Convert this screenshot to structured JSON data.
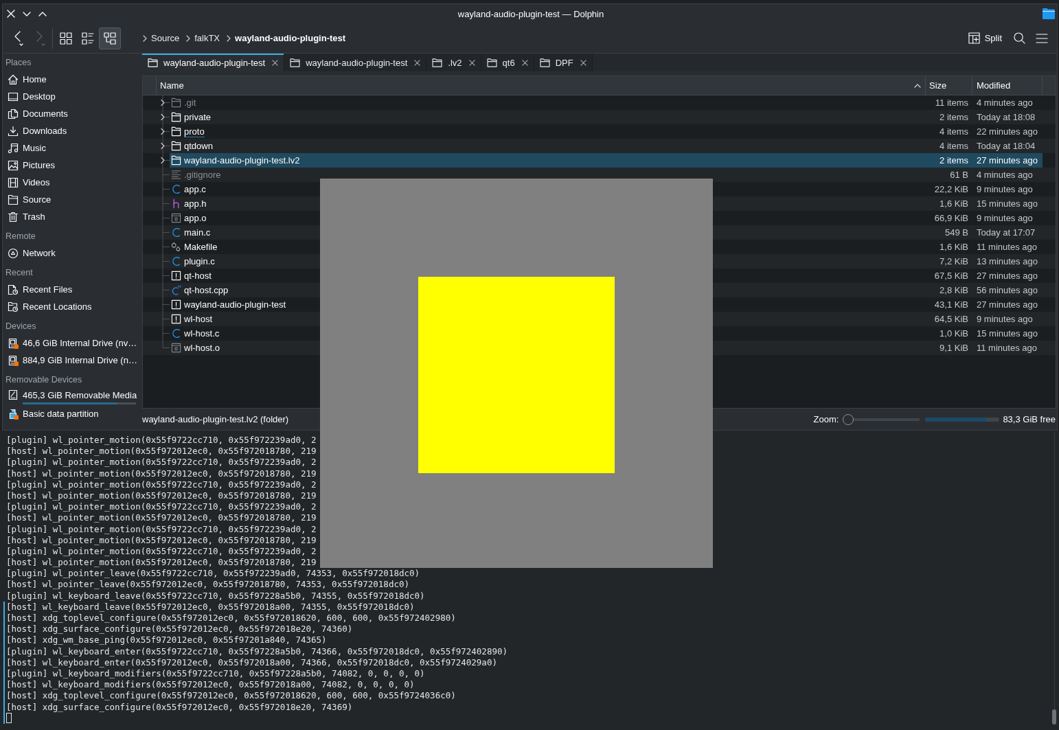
{
  "window": {
    "title": "wayland-audio-plugin-test — Dolphin"
  },
  "toolbar": {
    "back": {
      "disabled": false
    },
    "forward": {
      "disabled": true
    },
    "view_modes": [
      {
        "kind": "icons",
        "selected": false
      },
      {
        "kind": "compact",
        "selected": false
      },
      {
        "kind": "details",
        "selected": true
      }
    ],
    "breadcrumb": [
      {
        "label": "Source",
        "current": false
      },
      {
        "label": "falkTX",
        "current": false
      },
      {
        "label": "wayland-audio-plugin-test",
        "current": true
      }
    ],
    "split": {
      "label": "Split"
    }
  },
  "sidebar": [
    {
      "title": "Places",
      "items": [
        {
          "label": "Home",
          "kind": "home"
        },
        {
          "label": "Desktop",
          "kind": "desktop"
        },
        {
          "label": "Documents",
          "kind": "documents"
        },
        {
          "label": "Downloads",
          "kind": "downloads"
        },
        {
          "label": "Music",
          "kind": "music"
        },
        {
          "label": "Pictures",
          "kind": "pictures"
        },
        {
          "label": "Videos",
          "kind": "videos"
        },
        {
          "label": "Source",
          "kind": "folder"
        },
        {
          "label": "Trash",
          "kind": "trash"
        }
      ]
    },
    {
      "title": "Remote",
      "items": [
        {
          "label": "Network",
          "kind": "network"
        }
      ]
    },
    {
      "title": "Recent",
      "items": [
        {
          "label": "Recent Files",
          "kind": "recentfiles"
        },
        {
          "label": "Recent Locations",
          "kind": "recentlocations"
        }
      ]
    },
    {
      "title": "Devices",
      "items": [
        {
          "label": "46,6 GiB Internal Drive (nv…",
          "kind": "drive",
          "unmounted": true
        },
        {
          "label": "884,9 GiB Internal Drive (n…",
          "kind": "drive",
          "unmounted": true
        }
      ]
    },
    {
      "title": "Removable Devices",
      "items": [
        {
          "label": "465,3 GiB Removable Media",
          "kind": "removable",
          "unmounted": false,
          "level": 0.83
        },
        {
          "label": "Basic data partition",
          "kind": "usb",
          "unmounted": true
        }
      ]
    }
  ],
  "tabs": [
    {
      "label": "wayland-audio-plugin-test",
      "selected": true
    },
    {
      "label": "wayland-audio-plugin-test",
      "selected": false
    },
    {
      "label": ".lv2",
      "selected": false
    },
    {
      "label": "qt6",
      "selected": false
    },
    {
      "label": "DPF",
      "selected": false
    }
  ],
  "files": {
    "columns": [
      {
        "label": "Name",
        "sorted": true
      },
      {
        "label": "Size",
        "sorted": false
      },
      {
        "label": "Modified",
        "sorted": false
      }
    ],
    "rows": [
      {
        "name": ".git",
        "kind": "folder",
        "size": "11 items",
        "modified": "4 minutes ago",
        "selected": false,
        "hidden": true,
        "hovered": false
      },
      {
        "name": "private",
        "kind": "folder",
        "size": "2 items",
        "modified": "Today at 18:08",
        "selected": false,
        "hidden": false,
        "hovered": false
      },
      {
        "name": "proto",
        "kind": "folder",
        "size": "4 items",
        "modified": "22 minutes ago",
        "selected": false,
        "hidden": false,
        "hovered": true
      },
      {
        "name": "qtdown",
        "kind": "folder",
        "size": "4 items",
        "modified": "Today at 18:04",
        "selected": false,
        "hidden": false,
        "hovered": false
      },
      {
        "name": "wayland-audio-plugin-test.lv2",
        "kind": "folder",
        "size": "2 items",
        "modified": "27 minutes ago",
        "selected": true,
        "hidden": false,
        "hovered": false
      },
      {
        "name": ".gitignore",
        "kind": "text",
        "size": "61 B",
        "modified": "4 minutes ago",
        "selected": false,
        "hidden": true,
        "hovered": false
      },
      {
        "name": "app.c",
        "kind": "c",
        "size": "22,2 KiB",
        "modified": "9 minutes ago",
        "selected": false,
        "hidden": false,
        "hovered": false
      },
      {
        "name": "app.h",
        "kind": "header",
        "size": "1,6 KiB",
        "modified": "15 minutes ago",
        "selected": false,
        "hidden": false,
        "hovered": false
      },
      {
        "name": "app.o",
        "kind": "object",
        "size": "66,9 KiB",
        "modified": "9 minutes ago",
        "selected": false,
        "hidden": false,
        "hovered": false
      },
      {
        "name": "main.c",
        "kind": "c",
        "size": "549 B",
        "modified": "Today at 17:07",
        "selected": false,
        "hidden": false,
        "hovered": false
      },
      {
        "name": "Makefile",
        "kind": "makefile",
        "size": "1,6 KiB",
        "modified": "11 minutes ago",
        "selected": false,
        "hidden": false,
        "hovered": false
      },
      {
        "name": "plugin.c",
        "kind": "c",
        "size": "7,2 KiB",
        "modified": "13 minutes ago",
        "selected": false,
        "hidden": false,
        "hovered": false
      },
      {
        "name": "qt-host",
        "kind": "executable",
        "size": "67,5 KiB",
        "modified": "27 minutes ago",
        "selected": false,
        "hidden": false,
        "hovered": false
      },
      {
        "name": "qt-host.cpp",
        "kind": "cpp",
        "size": "2,8 KiB",
        "modified": "56 minutes ago",
        "selected": false,
        "hidden": false,
        "hovered": false
      },
      {
        "name": "wayland-audio-plugin-test",
        "kind": "executable",
        "size": "43,1 KiB",
        "modified": "27 minutes ago",
        "selected": false,
        "hidden": false,
        "hovered": false
      },
      {
        "name": "wl-host",
        "kind": "executable",
        "size": "64,5 KiB",
        "modified": "9 minutes ago",
        "selected": false,
        "hidden": false,
        "hovered": false
      },
      {
        "name": "wl-host.c",
        "kind": "c",
        "size": "1,0 KiB",
        "modified": "15 minutes ago",
        "selected": false,
        "hidden": false,
        "hovered": false
      },
      {
        "name": "wl-host.o",
        "kind": "object",
        "size": "9,1 KiB",
        "modified": "11 minutes ago",
        "selected": false,
        "hidden": false,
        "hovered": false
      }
    ]
  },
  "status_bar": {
    "text": "wayland-audio-plugin-test.lv2 (folder)",
    "zoom_label": "Zoom:",
    "zoom": {
      "level": 0
    },
    "free_space": {
      "level": 0.82
    },
    "free_text": "83,3 GiB free"
  },
  "test_window": {
    "square": true
  },
  "terminal": {
    "lines": [
      {
        "text": "[plugin] wl_pointer_motion(0x55f9722cc710, 0x55f972239ad0, 2",
        "marked": false
      },
      {
        "text": "[host] wl_pointer_motion(0x55f972012ec0, 0x55f972018780, 219",
        "marked": false
      },
      {
        "text": "[plugin] wl_pointer_motion(0x55f9722cc710, 0x55f972239ad0, 2",
        "marked": false
      },
      {
        "text": "[host] wl_pointer_motion(0x55f972012ec0, 0x55f972018780, 219",
        "marked": false
      },
      {
        "text": "[plugin] wl_pointer_motion(0x55f9722cc710, 0x55f972239ad0, 2",
        "marked": false
      },
      {
        "text": "[host] wl_pointer_motion(0x55f972012ec0, 0x55f972018780, 219",
        "marked": false
      },
      {
        "text": "[plugin] wl_pointer_motion(0x55f9722cc710, 0x55f972239ad0, 2",
        "marked": false
      },
      {
        "text": "[host] wl_pointer_motion(0x55f972012ec0, 0x55f972018780, 219",
        "marked": false
      },
      {
        "text": "[plugin] wl_pointer_motion(0x55f9722cc710, 0x55f972239ad0, 2",
        "marked": false
      },
      {
        "text": "[host] wl_pointer_motion(0x55f972012ec0, 0x55f972018780, 219",
        "marked": false
      },
      {
        "text": "[plugin] wl_pointer_motion(0x55f9722cc710, 0x55f972239ad0, 2",
        "marked": false
      },
      {
        "text": "[host] wl_pointer_motion(0x55f972012ec0, 0x55f972018780, 219",
        "marked": false
      },
      {
        "text": "[plugin] wl_pointer_leave(0x55f9722cc710, 0x55f972239ad0, 74353, 0x55f972018dc0)",
        "marked": false
      },
      {
        "text": "[host] wl_pointer_leave(0x55f972012ec0, 0x55f972018780, 74353, 0x55f972018dc0)",
        "marked": false
      },
      {
        "text": "[plugin] wl_keyboard_leave(0x55f9722cc710, 0x55f97228a5b0, 74355, 0x55f972018dc0)",
        "marked": false
      },
      {
        "text": "[host] wl_keyboard_leave(0x55f972012ec0, 0x55f972018a00, 74355, 0x55f972018dc0)",
        "marked": true
      },
      {
        "text": "[host] xdg_toplevel_configure(0x55f972012ec0, 0x55f972018620, 600, 600, 0x55f972402980)",
        "marked": true
      },
      {
        "text": "[host] xdg_surface_configure(0x55f972012ec0, 0x55f972018e20, 74360)",
        "marked": true
      },
      {
        "text": "[host] xdg_wm_base_ping(0x55f972012ec0, 0x55f97201a840, 74365)",
        "marked": true
      },
      {
        "text": "[plugin] wl_keyboard_enter(0x55f9722cc710, 0x55f97228a5b0, 74366, 0x55f972018dc0, 0x55f972402890)",
        "marked": true
      },
      {
        "text": "[host] wl_keyboard_enter(0x55f972012ec0, 0x55f972018a00, 74366, 0x55f972018dc0, 0x55f9724029a0)",
        "marked": true
      },
      {
        "text": "[plugin] wl_keyboard_modifiers(0x55f9722cc710, 0x55f97228a5b0, 74082, 0, 0, 0, 0)",
        "marked": true
      },
      {
        "text": "[host] wl_keyboard_modifiers(0x55f972012ec0, 0x55f972018a00, 74082, 0, 0, 0, 0)",
        "marked": true
      },
      {
        "text": "[host] xdg_toplevel_configure(0x55f972012ec0, 0x55f972018620, 600, 600, 0x55f9724036c0)",
        "marked": true
      },
      {
        "text": "[host] xdg_surface_configure(0x55f972012ec0, 0x55f972018e20, 74369)",
        "marked": true
      }
    ],
    "cursor": {
      "marked": true
    }
  }
}
